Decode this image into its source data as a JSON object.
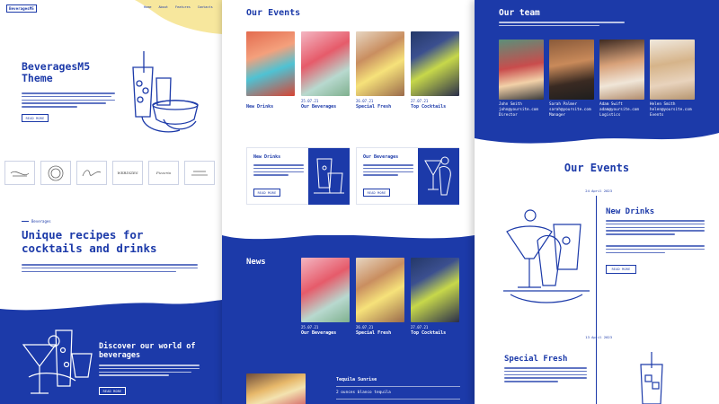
{
  "colors": {
    "brand": "#1c3aa9",
    "yellow": "#f7e79d",
    "white": "#ffffff"
  },
  "panel1": {
    "brand": "BeveragesM5",
    "nav": [
      "Home",
      "About",
      "Features",
      "Contacts"
    ],
    "hero": {
      "title_line1": "BeveragesM5",
      "title_line2": "Theme",
      "button": "READ MORE"
    },
    "logos": [
      "",
      "",
      "",
      "WEBDIZES",
      "Pizzeria",
      ""
    ],
    "section": {
      "kicker": "Beverages",
      "title_line1": "Unique recipes for",
      "title_line2": "cocktails and drinks"
    },
    "discover": {
      "title_line1": "Discover our world of",
      "title_line2": "beverages",
      "button": "READ MORE"
    }
  },
  "panel2": {
    "events_title": "Our Events",
    "events": [
      {
        "date": "",
        "title": "New Drinks"
      },
      {
        "date": "25.07.21",
        "title": "Our Beverages"
      },
      {
        "date": "26.07.21",
        "title": "Special Fresh"
      },
      {
        "date": "27.07.21",
        "title": "Top Cocktails"
      }
    ],
    "cards": [
      {
        "title": "New Drinks",
        "button": "READ MORE"
      },
      {
        "title": "Our Beverages",
        "button": "READ MORE"
      }
    ],
    "news_title": "News",
    "news": [
      {
        "date": "25.07.21",
        "title": "Our Beverages"
      },
      {
        "date": "26.07.21",
        "title": "Special Fresh"
      },
      {
        "date": "27.07.21",
        "title": "Top Cocktails"
      }
    ],
    "recipe": {
      "title": "Tequila Sunrise",
      "ingredient": "2 ounces blanco tequila"
    }
  },
  "panel3": {
    "team_title": "Our team",
    "team": [
      {
        "name": "John Smith",
        "email": "john@yoursite.com",
        "role": "Director"
      },
      {
        "name": "Sarah Palmer",
        "email": "sarah@yoursite.com",
        "role": "Manager"
      },
      {
        "name": "Adam Swift",
        "email": "adam@yoursite.com",
        "role": "Logistics"
      },
      {
        "name": "Helen Smith",
        "email": "helen@yoursite.com",
        "role": "Events"
      }
    ],
    "events_title": "Our Events",
    "event1": {
      "date": "24 April 2023",
      "title": "New Drinks",
      "button": "READ MORE"
    },
    "event2": {
      "date": "13 April 2023",
      "title": "Special Fresh"
    }
  }
}
